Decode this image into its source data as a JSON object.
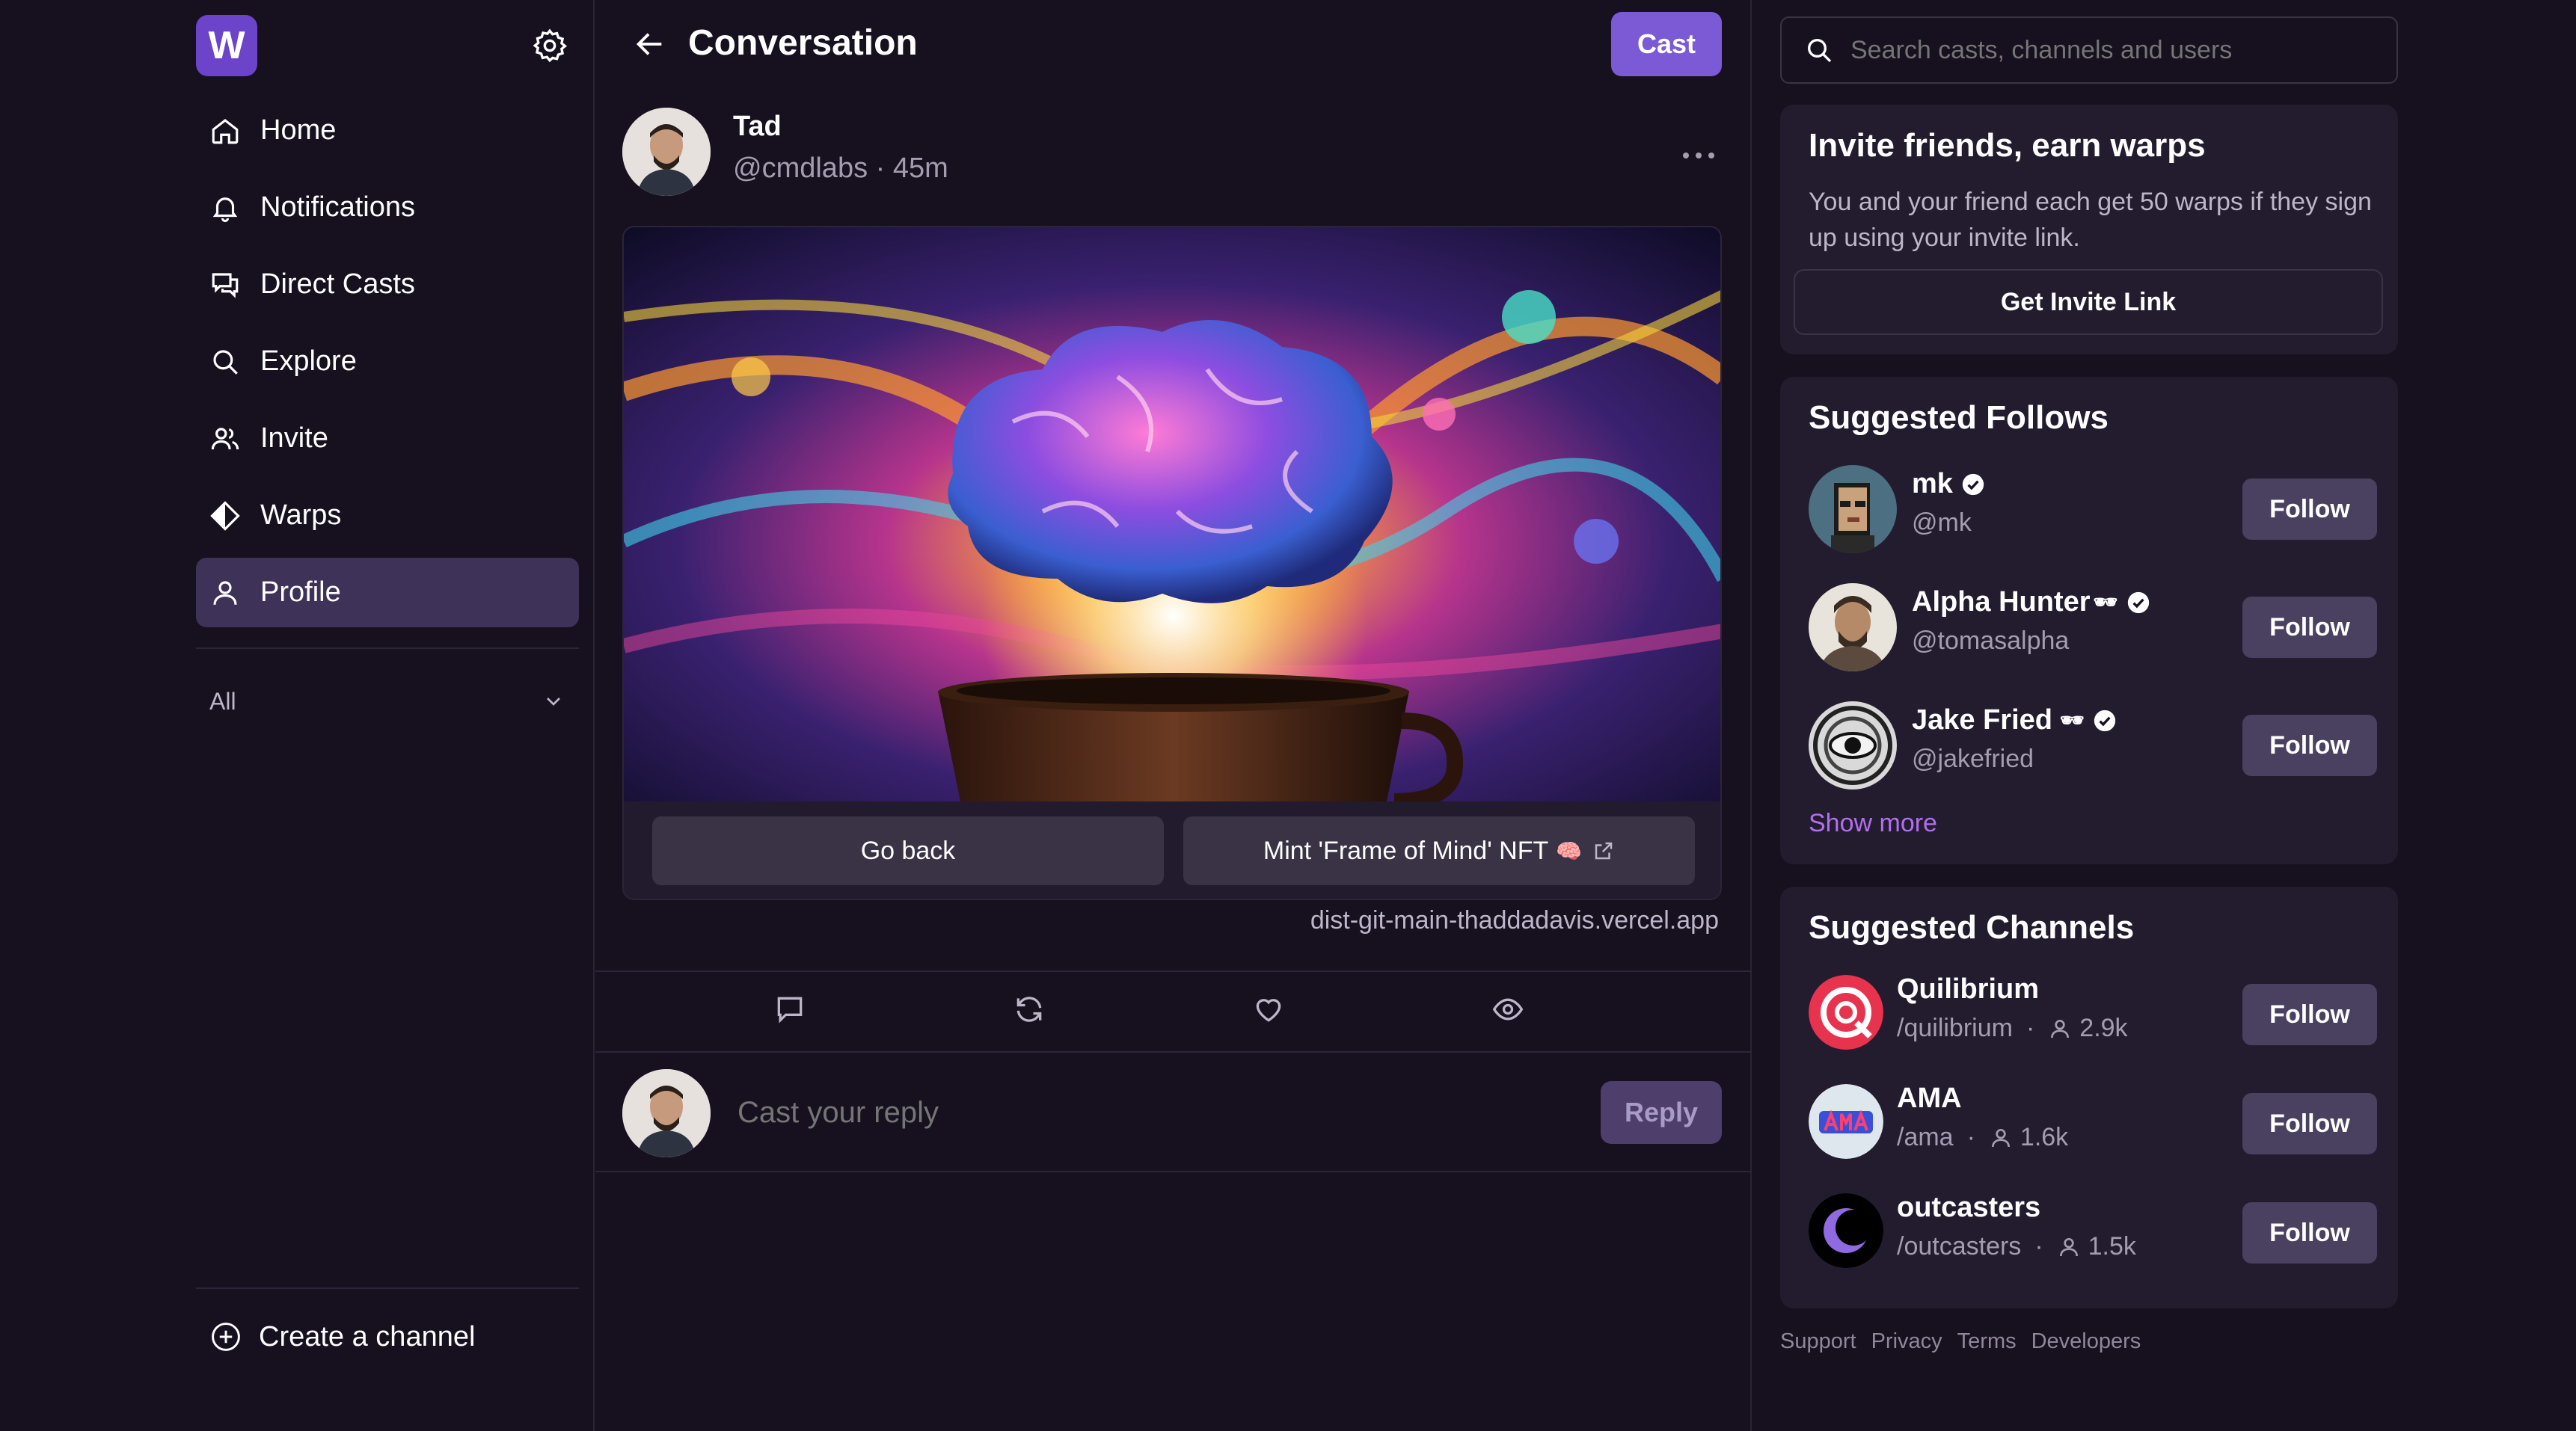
{
  "sidebar": {
    "logo_letter": "W",
    "nav": [
      {
        "label": "Home",
        "icon": "home-icon"
      },
      {
        "label": "Notifications",
        "icon": "bell-icon"
      },
      {
        "label": "Direct Casts",
        "icon": "chat-bubbles-icon"
      },
      {
        "label": "Explore",
        "icon": "search-icon"
      },
      {
        "label": "Invite",
        "icon": "people-icon"
      },
      {
        "label": "Warps",
        "icon": "diamond-icon"
      },
      {
        "label": "Profile",
        "icon": "person-icon",
        "active": true
      }
    ],
    "feed_filter": "All",
    "create_channel_label": "Create a channel"
  },
  "conversation": {
    "title": "Conversation",
    "cast_button": "Cast",
    "author": {
      "name": "Tad",
      "meta": "@cmdlabs · 45m"
    },
    "frame": {
      "button_back": "Go back",
      "button_mint": "Mint 'Frame of Mind' NFT",
      "mint_emoji": "🧠",
      "url": "dist-git-main-thaddadavis.vercel.app"
    },
    "reply_placeholder": "Cast your reply",
    "reply_button": "Reply"
  },
  "right": {
    "search_placeholder": "Search casts, channels and users",
    "invite": {
      "title": "Invite friends, earn warps",
      "text": "You and your friend each get 50 warps if they sign up using your invite link.",
      "button": "Get Invite Link"
    },
    "suggested_follows": {
      "title": "Suggested Follows",
      "users": [
        {
          "name": "mk",
          "handle": "@mk",
          "extra": "",
          "follow": "Follow"
        },
        {
          "name": "Alpha Hunter",
          "handle": "@tomasalpha",
          "extra": "🕶",
          "follow": "Follow"
        },
        {
          "name": "Jake Fried",
          "handle": "@jakefried",
          "extra": "🕶",
          "follow": "Follow"
        }
      ],
      "show_more": "Show more"
    },
    "suggested_channels": {
      "title": "Suggested Channels",
      "channels": [
        {
          "name": "Quilibrium",
          "handle": "/quilibrium",
          "members": "2.9k",
          "follow": "Follow"
        },
        {
          "name": "AMA",
          "handle": "/ama",
          "members": "1.6k",
          "follow": "Follow"
        },
        {
          "name": "outcasters",
          "handle": "/outcasters",
          "members": "1.5k",
          "follow": "Follow"
        }
      ]
    },
    "footer": [
      "Support",
      "Privacy",
      "Terms",
      "Developers"
    ]
  },
  "colors": {
    "background": "#17101f",
    "panel": "#231c2e",
    "accent": "#7c5ad6",
    "link": "#b36ef0"
  }
}
